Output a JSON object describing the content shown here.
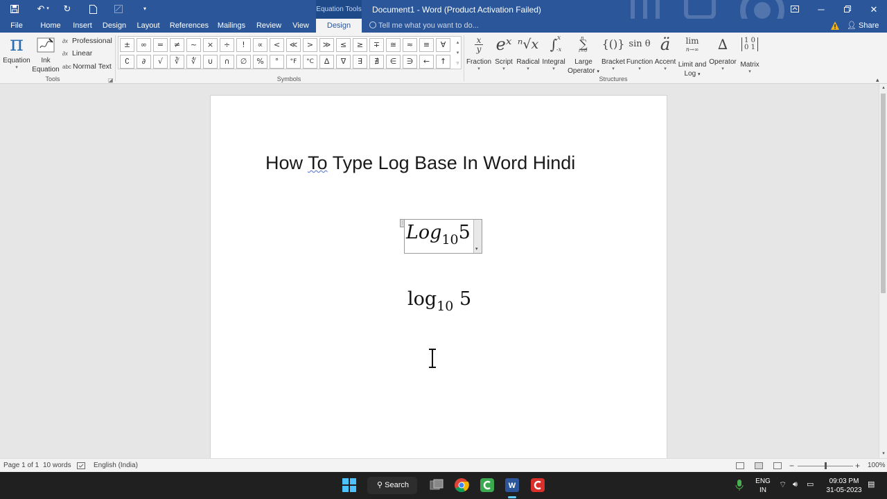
{
  "titlebar": {
    "context_label": "Equation Tools",
    "document_title": "Document1 - Word (Product Activation Failed)"
  },
  "tabs": [
    {
      "label": "File"
    },
    {
      "label": "Home"
    },
    {
      "label": "Insert"
    },
    {
      "label": "Design"
    },
    {
      "label": "Layout"
    },
    {
      "label": "References"
    },
    {
      "label": "Mailings"
    },
    {
      "label": "Review"
    },
    {
      "label": "View"
    },
    {
      "label": "Design",
      "active": true
    }
  ],
  "tell_me": "Tell me what you want to do...",
  "share_label": "Share",
  "ribbon": {
    "tools": {
      "label": "Tools",
      "equation": "Equation",
      "ink_line1": "Ink",
      "ink_line2": "Equation",
      "professional": "Professional",
      "linear": "Linear",
      "normal_text": "Normal Text",
      "normal_text_icon": "abc"
    },
    "symbols": {
      "label": "Symbols",
      "row1": [
        "±",
        "∞",
        "=",
        "≠",
        "~",
        "×",
        "÷",
        "!",
        "∝",
        "<",
        "≪",
        ">",
        "≫",
        "≤",
        "≥",
        "∓",
        "≅",
        "≈",
        "≡",
        "∀"
      ],
      "row2": [
        "∁",
        "∂",
        "√",
        "∛",
        "∜",
        "∪",
        "∩",
        "∅",
        "%",
        "°",
        "°F",
        "°C",
        "∆",
        "∇",
        "∃",
        "∄",
        "∈",
        "∋",
        "←",
        "↑"
      ]
    },
    "structures": {
      "label": "Structures",
      "fraction": {
        "label": "Fraction",
        "glyph_num": "x",
        "glyph_den": "y"
      },
      "script": {
        "label": "Script",
        "glyph": "eˣ"
      },
      "radical": {
        "label": "Radical",
        "glyph": "ⁿ√x"
      },
      "integral": {
        "label": "Integral",
        "glyph": "∫",
        "glyph_up": "x",
        "glyph_low": "-x"
      },
      "large_operator": {
        "label_line1": "Large",
        "label_line2": "Operator",
        "glyph": "∑",
        "glyph_up": "n",
        "glyph_low": "i=0"
      },
      "bracket": {
        "label": "Bracket",
        "glyph": "{()}"
      },
      "function": {
        "label": "Function",
        "glyph": "sin θ"
      },
      "accent": {
        "label": "Accent",
        "glyph": "ä"
      },
      "limit": {
        "label_line1": "Limit and",
        "label_line2": "Log",
        "glyph": "lim",
        "glyph_low": "n→∞"
      },
      "operator": {
        "label": "Operator",
        "glyph": "∆"
      },
      "matrix": {
        "label": "Matrix",
        "glyph_row1": "1 0",
        "glyph_row2": "0 1"
      }
    }
  },
  "document": {
    "heading": {
      "pre": "How ",
      "squiggle": "To",
      "post": " Type Log Base In Word Hindi"
    },
    "equation1": {
      "fn": "Log",
      "sub": "10",
      "arg": "5"
    },
    "equation2": {
      "fn": "log",
      "sub": "10",
      "arg": "5"
    }
  },
  "statusbar": {
    "page": "Page 1 of 1",
    "words": "10 words",
    "language": "English (India)",
    "zoom": "100%",
    "zoom_level_pct": 100
  },
  "taskbar": {
    "search": "Search",
    "lang1": "ENG",
    "lang2": "IN",
    "time": "09:03 PM",
    "date": "31-05-2023"
  },
  "colors": {
    "word_blue": "#2b579a",
    "ribbon_bg": "#f3f3f3",
    "canvas_bg": "#e6e6e6",
    "taskbar_bg": "#202020"
  }
}
